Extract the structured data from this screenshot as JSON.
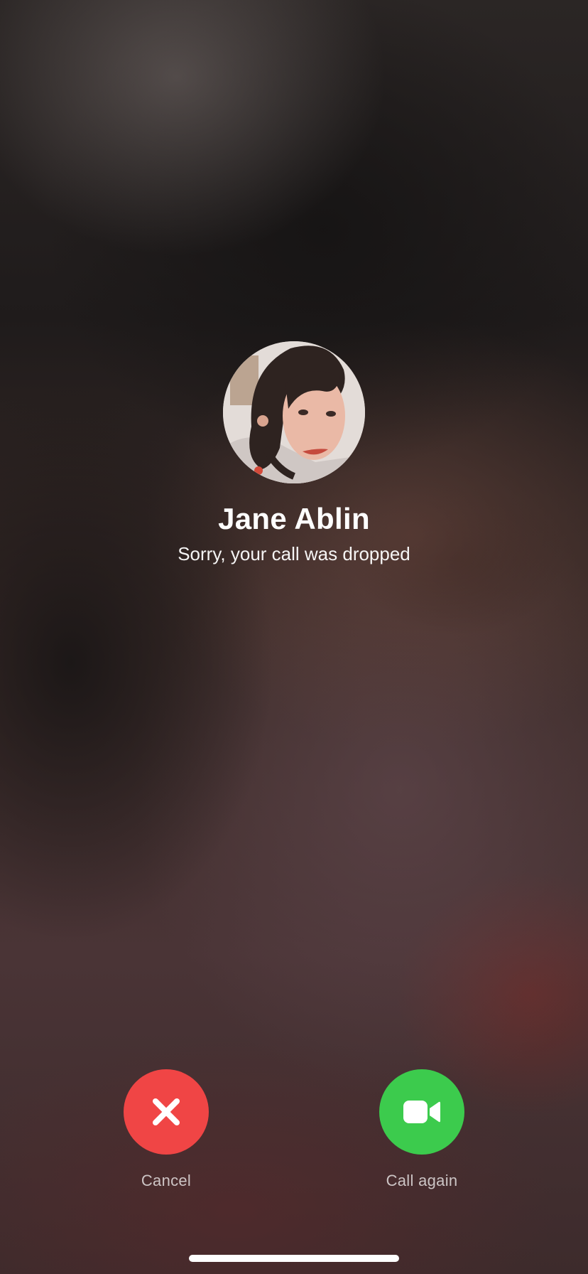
{
  "call": {
    "contact_name": "Jane Ablin",
    "status": "Sorry, your call was dropped"
  },
  "actions": {
    "cancel": {
      "label": "Cancel",
      "icon": "close-icon",
      "color": "#f04545"
    },
    "call_again": {
      "label": "Call again",
      "icon": "video-camera-icon",
      "color": "#3ccb4d"
    }
  }
}
